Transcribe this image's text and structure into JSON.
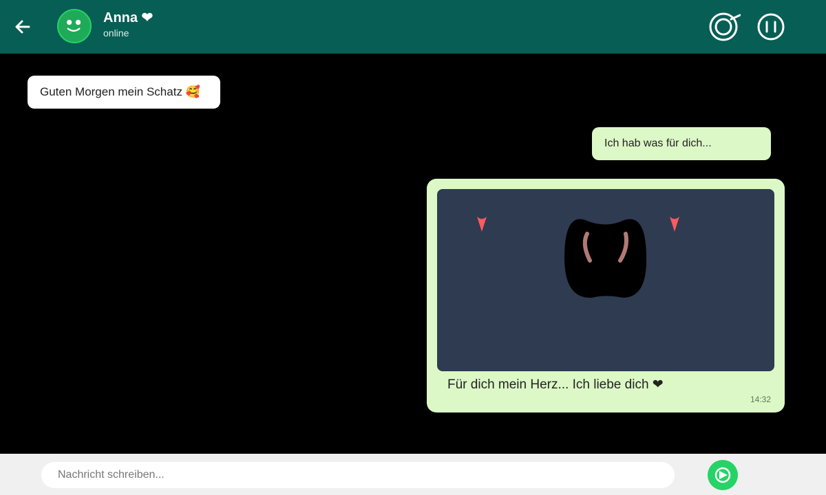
{
  "header": {
    "contact_name": "Anna ❤",
    "status": "online"
  },
  "messages": [
    {
      "direction": "incoming",
      "text": "Guten Morgen mein Schatz 🥰"
    },
    {
      "direction": "outgoing",
      "text": "Ich hab was für dich..."
    },
    {
      "direction": "outgoing",
      "caption": "Für dich mein Herz... Ich liebe dich ❤",
      "time": "14:32"
    }
  ],
  "composer": {
    "placeholder": "Nachricht schreiben..."
  },
  "icons": {
    "back": "arrow-left-icon",
    "avatar": "smiley-icon",
    "camera": "camera-icon",
    "pause": "pause-icon",
    "send": "send-icon"
  },
  "colors": {
    "header": "#075e54",
    "outgoing_bubble": "#dcf8c6",
    "incoming_bubble": "#ffffff",
    "accent": "#25d366",
    "media_bg": "#2e3b50",
    "heart": "#ff5a5f"
  }
}
